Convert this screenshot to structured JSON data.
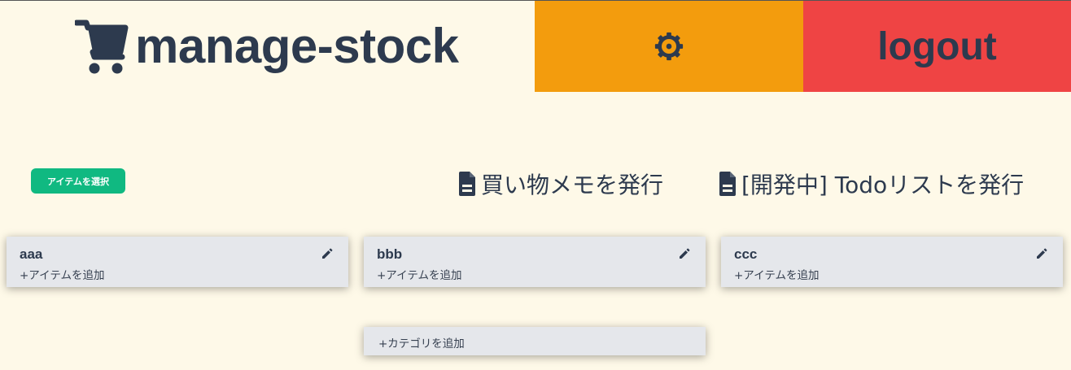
{
  "header": {
    "app_title": "manage-stock",
    "logout_label": "logout",
    "brand_icon": "shopping-cart-icon",
    "settings_icon": "gear-icon",
    "settings_color": "#f39c0d",
    "logout_color": "#ef4444"
  },
  "toolbar": {
    "select_items_label": "アイテムを選択",
    "issue_shopping_memo_label": "買い物メモを発行",
    "issue_todo_list_label": "[開発中] Todoリストを発行",
    "doc_icon": "file-document-icon",
    "select_badge_color": "#10b981"
  },
  "categories": [
    {
      "name": "aaa",
      "add_item_label": "+アイテムを追加"
    },
    {
      "name": "bbb",
      "add_item_label": "+アイテムを追加"
    },
    {
      "name": "ccc",
      "add_item_label": "+アイテムを追加"
    }
  ],
  "add_category_label": "+カテゴリを追加",
  "colors": {
    "background": "#fef9e8",
    "text": "#2d3a4e",
    "card": "#e5e7eb"
  }
}
